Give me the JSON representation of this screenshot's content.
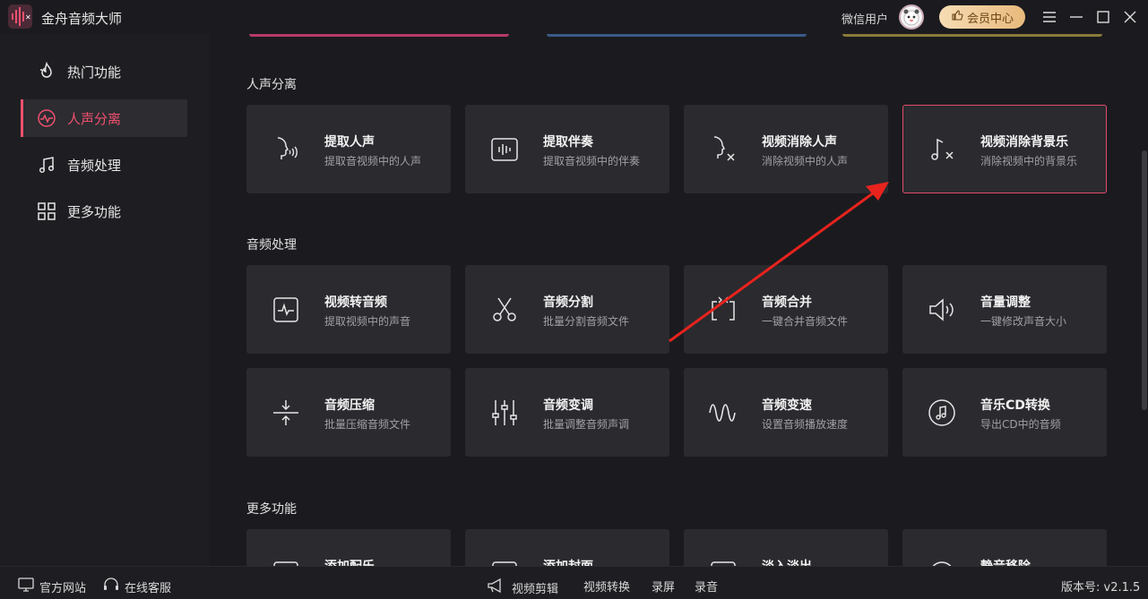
{
  "app": {
    "title": "金舟音频大师"
  },
  "user": {
    "name": "微信用户"
  },
  "vip": {
    "label": "会员中心"
  },
  "sidebar": {
    "items": [
      {
        "label": "热门功能",
        "icon": "fire-icon"
      },
      {
        "label": "人声分离",
        "icon": "waveform-icon"
      },
      {
        "label": "音频处理",
        "icon": "music-note-icon"
      },
      {
        "label": "更多功能",
        "icon": "grid-icon"
      }
    ]
  },
  "sections": {
    "vocal": {
      "title": "人声分离"
    },
    "audio": {
      "title": "音频处理"
    },
    "more": {
      "title": "更多功能"
    }
  },
  "cards": {
    "vocal": [
      {
        "title": "提取人声",
        "sub": "提取音视频中的人声"
      },
      {
        "title": "提取伴奏",
        "sub": "提取音视频中的伴奏"
      },
      {
        "title": "视频消除人声",
        "sub": "消除视频中的人声"
      },
      {
        "title": "视频消除背景乐",
        "sub": "消除视频中的背景乐"
      }
    ],
    "audio": [
      {
        "title": "视频转音频",
        "sub": "提取视频中的声音"
      },
      {
        "title": "音频分割",
        "sub": "批量分割音频文件"
      },
      {
        "title": "音频合并",
        "sub": "一键合并音频文件"
      },
      {
        "title": "音量调整",
        "sub": "一键修改声音大小"
      },
      {
        "title": "音频压缩",
        "sub": "批量压缩音频文件"
      },
      {
        "title": "音频变调",
        "sub": "批量调整音频声调"
      },
      {
        "title": "音频变速",
        "sub": "设置音频播放速度"
      },
      {
        "title": "音乐CD转换",
        "sub": "导出CD中的音频"
      }
    ],
    "more": [
      {
        "title": "添加配乐"
      },
      {
        "title": "添加封面"
      },
      {
        "title": "淡入淡出"
      },
      {
        "title": "静音移除"
      }
    ]
  },
  "footer": {
    "website": "官方网站",
    "support": "在线客服",
    "links": [
      "视频剪辑",
      "视频转换",
      "录屏",
      "录音"
    ],
    "version": "版本号: v2.1.5"
  },
  "colors": {
    "accent": "#f0506e",
    "card": "#2a2a2f",
    "background": "#1b1b1f"
  }
}
